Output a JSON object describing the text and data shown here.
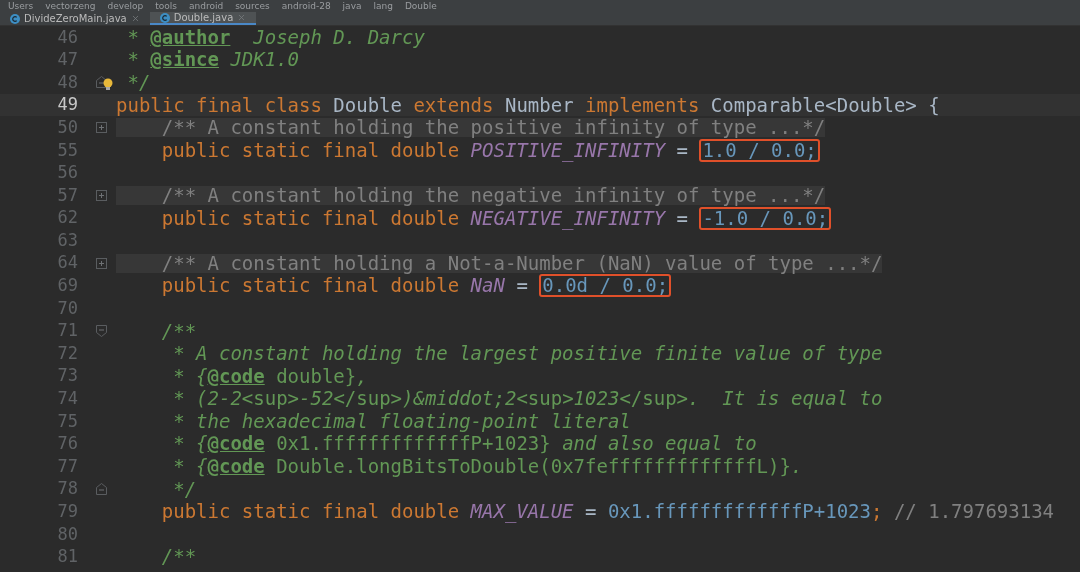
{
  "breadcrumb": [
    "Users",
    "vectorzeng",
    "develop",
    "tools",
    "android",
    "sources",
    "android-28",
    "java",
    "lang",
    "Double"
  ],
  "tabs": [
    {
      "label": "DivideZeroMain.java",
      "selected": false
    },
    {
      "label": "Double.java",
      "selected": true
    }
  ],
  "lines": [
    {
      "number": "46",
      "tokens": [
        {
          "kind": "doc",
          "text": " * "
        },
        {
          "kind": "tag",
          "text": "@author"
        },
        {
          "kind": "doc",
          "text": "  Joseph D. Darcy"
        }
      ]
    },
    {
      "number": "47",
      "tokens": [
        {
          "kind": "doc",
          "text": " * "
        },
        {
          "kind": "tag",
          "text": "@since"
        },
        {
          "kind": "doc",
          "text": " JDK1.0"
        }
      ]
    },
    {
      "number": "48",
      "kind": "foldend",
      "bulb": true,
      "tokens": [
        {
          "kind": "doc",
          "text": " */"
        }
      ]
    },
    {
      "number": "49",
      "current": true,
      "tokens": [
        {
          "kind": "kw",
          "text": "public final class "
        },
        {
          "kind": "text",
          "text": "Double "
        },
        {
          "kind": "kw",
          "text": "extends "
        },
        {
          "kind": "text",
          "text": "Number "
        },
        {
          "kind": "kw",
          "text": "implements "
        },
        {
          "kind": "text",
          "text": "Comparable<Double> {"
        }
      ]
    },
    {
      "number": "50",
      "kind": "foldplus",
      "folded": true,
      "tokens": [
        {
          "kind": "comment",
          "text": "    /** A constant holding the positive infinity of type ...*/"
        }
      ]
    },
    {
      "number": "55",
      "tokens": [
        {
          "kind": "kw",
          "text": "    public static final double "
        },
        {
          "kind": "const",
          "text": "POSITIVE_INFINITY"
        },
        {
          "kind": "text",
          "text": " = "
        },
        {
          "kind": "boxed",
          "text": "1.0 / 0.0;"
        }
      ]
    },
    {
      "number": "56"
    },
    {
      "number": "57",
      "kind": "foldplus",
      "folded": true,
      "tokens": [
        {
          "kind": "comment",
          "text": "    /** A constant holding the negative infinity of type ...*/"
        }
      ]
    },
    {
      "number": "62",
      "tokens": [
        {
          "kind": "kw",
          "text": "    public static final double "
        },
        {
          "kind": "const",
          "text": "NEGATIVE_INFINITY"
        },
        {
          "kind": "text",
          "text": " = "
        },
        {
          "kind": "boxed",
          "text": "-1.0 / 0.0;"
        }
      ]
    },
    {
      "number": "63"
    },
    {
      "number": "64",
      "kind": "foldplus",
      "folded": true,
      "tokens": [
        {
          "kind": "comment",
          "text": "    /** A constant holding a Not-a-Number (NaN) value of type ...*/"
        }
      ]
    },
    {
      "number": "69",
      "tokens": [
        {
          "kind": "kw",
          "text": "    public static final double "
        },
        {
          "kind": "const",
          "text": "NaN"
        },
        {
          "kind": "text",
          "text": " = "
        },
        {
          "kind": "boxed",
          "text": "0.0d / 0.0;"
        }
      ]
    },
    {
      "number": "70"
    },
    {
      "number": "71",
      "kind": "foldstart",
      "tokens": [
        {
          "kind": "doc",
          "text": "    /**"
        }
      ]
    },
    {
      "number": "72",
      "tokens": [
        {
          "kind": "doc",
          "text": "     * A constant holding the largest positive finite value of type"
        }
      ]
    },
    {
      "number": "73",
      "tokens": [
        {
          "kind": "doc",
          "text": "     * {"
        },
        {
          "kind": "tag",
          "text": "@code"
        },
        {
          "kind": "docplain",
          "text": " double}"
        },
        {
          "kind": "doc",
          "text": ","
        }
      ]
    },
    {
      "number": "74",
      "tokens": [
        {
          "kind": "doc",
          "text": "     * (2-2"
        },
        {
          "kind": "docplain",
          "text": "<sup>"
        },
        {
          "kind": "doc",
          "text": "-52"
        },
        {
          "kind": "docplain",
          "text": "</sup>"
        },
        {
          "kind": "doc",
          "text": ")&middot;2"
        },
        {
          "kind": "docplain",
          "text": "<sup>"
        },
        {
          "kind": "doc",
          "text": "1023"
        },
        {
          "kind": "docplain",
          "text": "</sup>"
        },
        {
          "kind": "doc",
          "text": ".  It is equal to"
        }
      ]
    },
    {
      "number": "75",
      "tokens": [
        {
          "kind": "doc",
          "text": "     * the hexadecimal floating-point literal"
        }
      ]
    },
    {
      "number": "76",
      "tokens": [
        {
          "kind": "doc",
          "text": "     * {"
        },
        {
          "kind": "tag",
          "text": "@code"
        },
        {
          "kind": "docplain",
          "text": " 0x1.fffffffffffffP+1023}"
        },
        {
          "kind": "doc",
          "text": " and also equal to"
        }
      ]
    },
    {
      "number": "77",
      "tokens": [
        {
          "kind": "doc",
          "text": "     * {"
        },
        {
          "kind": "tag",
          "text": "@code"
        },
        {
          "kind": "docplain",
          "text": " Double.longBitsToDouble(0x7fefffffffffffffL)}"
        },
        {
          "kind": "doc",
          "text": "."
        }
      ]
    },
    {
      "number": "78",
      "kind": "foldend",
      "tokens": [
        {
          "kind": "doc",
          "text": "     */"
        }
      ]
    },
    {
      "number": "79",
      "tokens": [
        {
          "kind": "kw",
          "text": "    public static final double "
        },
        {
          "kind": "const",
          "text": "MAX_VALUE"
        },
        {
          "kind": "text",
          "text": " = "
        },
        {
          "kind": "num",
          "text": "0x1.fffffffffffffP+1023"
        },
        {
          "kind": "kw",
          "text": "; "
        },
        {
          "kind": "comment",
          "text": "// 1.797693134"
        }
      ]
    },
    {
      "number": "80"
    },
    {
      "number": "81",
      "tokens": [
        {
          "kind": "doc",
          "text": "    /**"
        }
      ]
    }
  ]
}
